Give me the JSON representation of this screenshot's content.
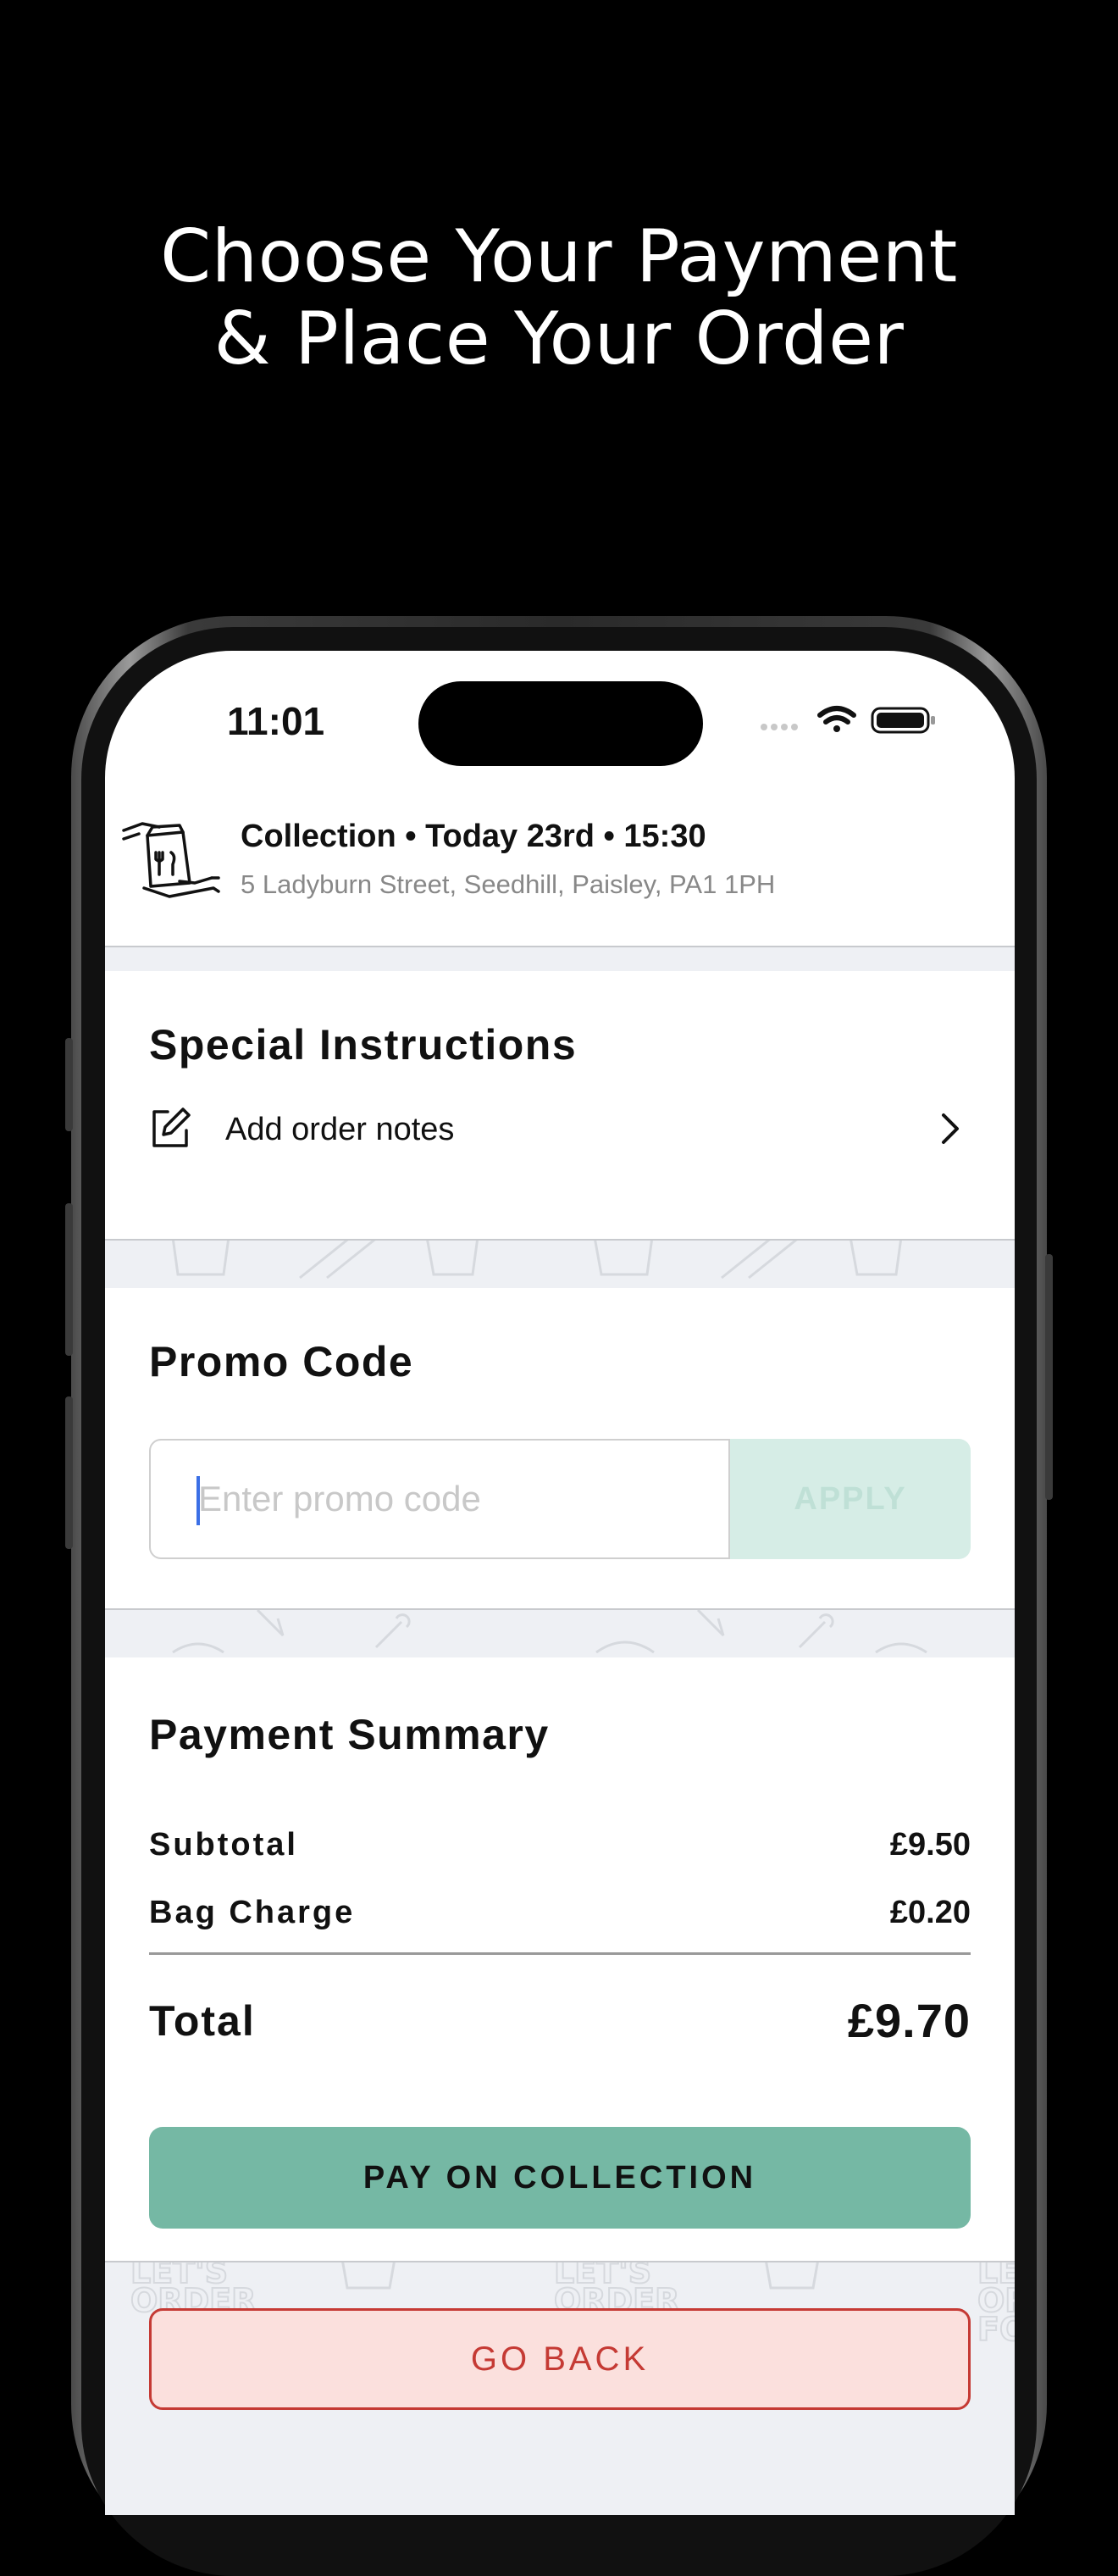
{
  "headline": {
    "line1": "Choose Your Payment",
    "line2": "& Place Your Order"
  },
  "status_bar": {
    "time": "11:01"
  },
  "order_header": {
    "mode": "Collection",
    "day": "Today 23rd",
    "time": "15:30",
    "line1": "Collection • Today 23rd • 15:30",
    "address": "5 Ladyburn Street, Seedhill, Paisley, PA1  1PH"
  },
  "special_instructions": {
    "title": "Special Instructions",
    "notes_label": "Add order notes"
  },
  "promo": {
    "title": "Promo Code",
    "placeholder": "Enter promo code",
    "apply_label": "APPLY"
  },
  "payment_summary": {
    "title": "Payment Summary",
    "rows": [
      {
        "label": "Subtotal",
        "value": "£9.50"
      },
      {
        "label": "Bag Charge",
        "value": "£0.20"
      }
    ],
    "total_label": "Total",
    "total_value": "£9.70",
    "pay_label": "PAY ON COLLECTION"
  },
  "footer": {
    "back_label": "GO BACK",
    "watermark_lines": [
      "LET'S",
      "ORDER",
      "FOOD"
    ]
  },
  "colors": {
    "accent_green": "#75b8a4",
    "apply_disabled": "#d6ede6",
    "back_red": "#c53a34",
    "back_bg": "#fbe0dd",
    "caret_blue": "#3b6fe6"
  }
}
